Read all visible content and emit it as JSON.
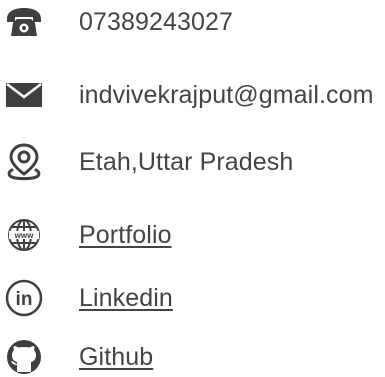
{
  "contact": {
    "phone": {
      "icon": "telephone-icon",
      "text": "07389243027"
    },
    "email": {
      "icon": "envelope-icon",
      "text": "indvivekrajput@gmail.com"
    },
    "location": {
      "icon": "location-pin-icon",
      "text": "Etah,Uttar Pradesh"
    }
  },
  "links": {
    "portfolio": {
      "icon": "globe-www-icon",
      "label": "Portfolio"
    },
    "linkedin": {
      "icon": "linkedin-icon",
      "label": "Linkedin"
    },
    "github": {
      "icon": "github-icon",
      "label": "Github"
    }
  },
  "colors": {
    "text": "#444444",
    "icon": "#3f3f3f",
    "background": "#ffffff"
  }
}
